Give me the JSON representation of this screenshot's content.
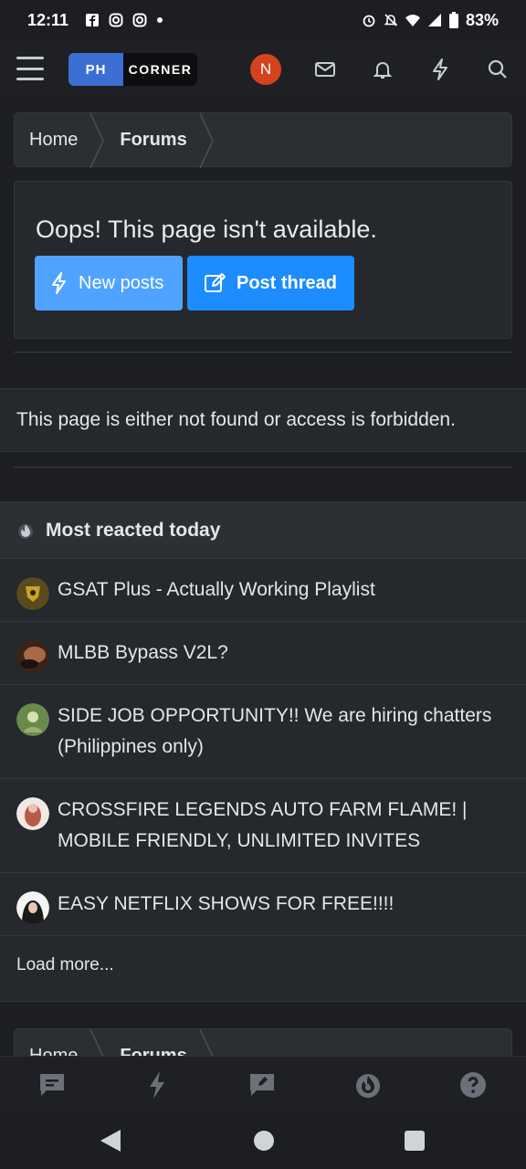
{
  "status_bar": {
    "time": "12:11",
    "battery": "83%"
  },
  "header": {
    "logo_ph": "PH",
    "logo_corner": "CORNER",
    "avatar_initial": "N",
    "icons": [
      "menu-icon",
      "mail-icon",
      "bell-icon",
      "bolt-icon",
      "search-icon"
    ]
  },
  "breadcrumb": {
    "home": "Home",
    "forums": "Forums"
  },
  "notice": {
    "title": "Oops! This page isn't available.",
    "new_posts_label": "New posts",
    "post_thread_label": "Post thread"
  },
  "error_message": "This page is either not found or access is forbidden.",
  "most_reacted": {
    "title": "Most reacted today",
    "items": [
      {
        "title": "GSAT Plus - Actually Working Playlist"
      },
      {
        "title": "MLBB Bypass V2L?"
      },
      {
        "title": "SIDE JOB OPPORTUNITY!! We are hiring chatters (Philippines only)"
      },
      {
        "title": "CROSSFIRE LEGENDS AUTO FARM FLAME! | MOBILE FRIENDLY, UNLIMITED INVITES"
      },
      {
        "title": "EASY NETFLIX SHOWS FOR FREE!!!!"
      }
    ],
    "load_more": "Load more..."
  },
  "bottom_breadcrumb": {
    "home": "Home",
    "forums": "Forums"
  },
  "colors": {
    "accent": "#1d8cff",
    "accent_light": "#4fa3ff",
    "avatar": "#d4431e",
    "background": "#1c1e21"
  }
}
